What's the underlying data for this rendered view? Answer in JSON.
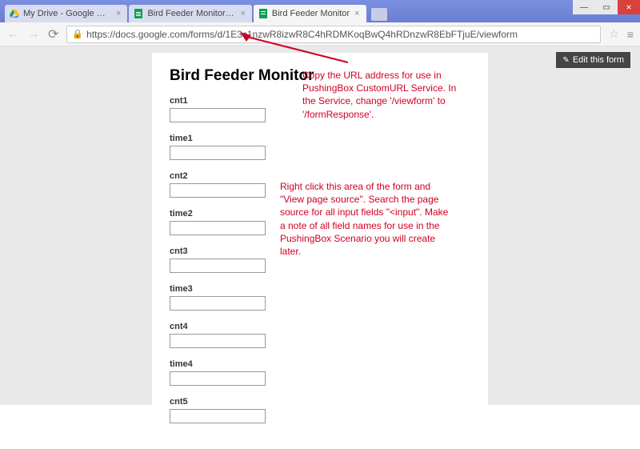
{
  "window": {
    "min": "—",
    "max": "▭",
    "close": "×"
  },
  "tabs": [
    {
      "title": "My Drive - Google Drive",
      "close": "×"
    },
    {
      "title": "Bird Feeder Monitor - Goo",
      "close": "×"
    },
    {
      "title": "Bird Feeder Monitor",
      "close": "×"
    }
  ],
  "nav": {
    "back": "←",
    "fwd": "→",
    "reload": "⟳",
    "star": "☆",
    "menu": "≡"
  },
  "url": {
    "lock": "🔒",
    "text": "https://docs.google.com/forms/d/1E3c1nzwR8izwR8C4hRDMKoqBwQ4hRDnzwR8EbFTjuE/viewform"
  },
  "edit_button": {
    "icon": "✎",
    "label": "Edit this form"
  },
  "form": {
    "title": "Bird Feeder Monitor",
    "fields": [
      {
        "label": "cnt1"
      },
      {
        "label": "time1"
      },
      {
        "label": "cnt2"
      },
      {
        "label": "time2"
      },
      {
        "label": "cnt3"
      },
      {
        "label": "time3"
      },
      {
        "label": "cnt4"
      },
      {
        "label": "time4"
      },
      {
        "label": "cnt5"
      }
    ]
  },
  "annotations": {
    "a1": "Copy the URL address for use in PushingBox CustomURL Service. In the Service, change '/viewform' to '/formResponse'.",
    "a2": "Right click this area of the form and \"View page source\".  Search the page source for all input fields \"<input\".  Make a note of all field names for use in the PushingBox Scenario you will create later."
  }
}
